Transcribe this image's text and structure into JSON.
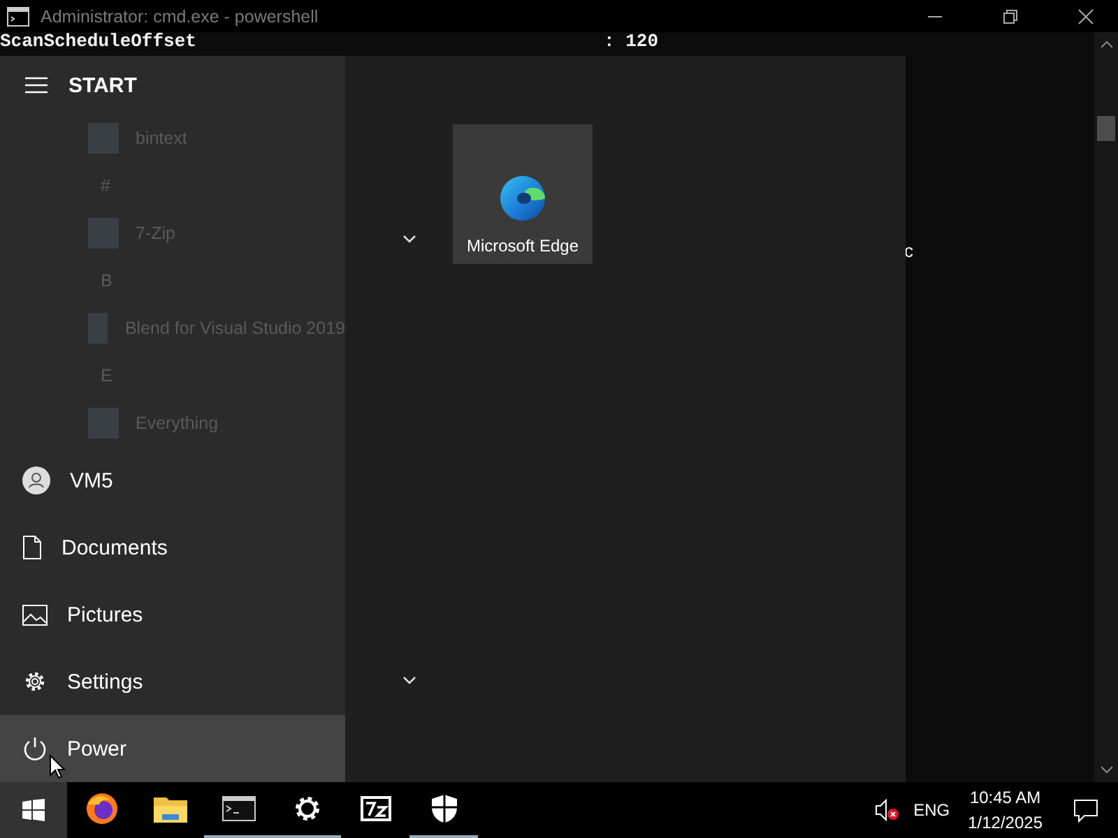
{
  "window": {
    "title": "Administrator: cmd.exe - powershell",
    "active": false
  },
  "console": {
    "lines": [
      {
        "name": "ScanScheduleOffset",
        "value": ": 120"
      }
    ],
    "fragment": "c"
  },
  "start_menu": {
    "title": "START",
    "app_list": [
      {
        "kind": "app",
        "label": "bintext"
      },
      {
        "kind": "letter",
        "label": "#"
      },
      {
        "kind": "app",
        "label": "7-Zip"
      },
      {
        "kind": "letter",
        "label": "B"
      },
      {
        "kind": "app",
        "label": "Blend for Visual Studio 2019"
      },
      {
        "kind": "letter",
        "label": "E"
      },
      {
        "kind": "app",
        "label": "Everything"
      }
    ],
    "rail": [
      {
        "kind": "user",
        "label": "VM5",
        "highlighted": false
      },
      {
        "kind": "documents",
        "label": "Documents",
        "highlighted": false
      },
      {
        "kind": "pictures",
        "label": "Pictures",
        "highlighted": false
      },
      {
        "kind": "settings",
        "label": "Settings",
        "highlighted": false
      },
      {
        "kind": "power",
        "label": "Power",
        "highlighted": true
      }
    ],
    "tiles": [
      {
        "label": "Microsoft Edge"
      }
    ]
  },
  "taskbar": {
    "apps": [
      {
        "kind": "firefox",
        "running": false
      },
      {
        "kind": "explorer",
        "running": false
      },
      {
        "kind": "cmd",
        "running": true
      },
      {
        "kind": "settings",
        "running": true
      },
      {
        "kind": "archiver",
        "running": false
      },
      {
        "kind": "security",
        "running": true
      }
    ],
    "language": "ENG",
    "time": "10:45 AM",
    "date": "1/12/2025"
  }
}
